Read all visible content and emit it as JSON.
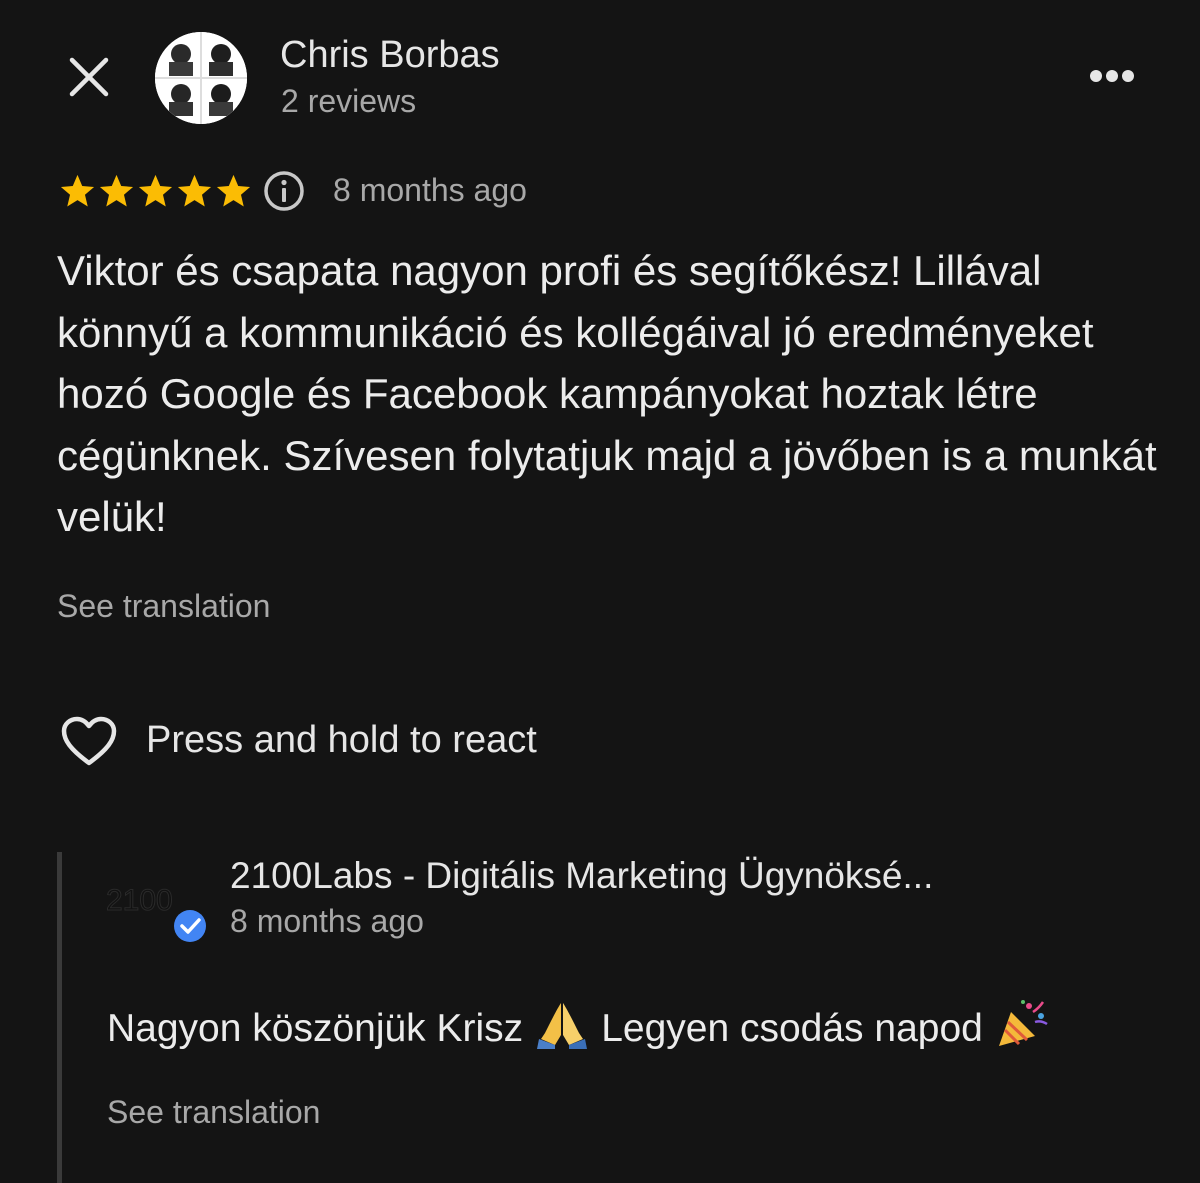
{
  "header": {
    "close_icon": "close-icon",
    "reviewer_name": "Chris Borbas",
    "review_count": "2 reviews",
    "more_icon": "more-horizontal-icon"
  },
  "review": {
    "rating": 5,
    "rating_max": 5,
    "star_color": "#fbbc04",
    "info_icon": "info-icon",
    "date": "8 months ago",
    "text": "Viktor és csapata nagyon profi és segítőkész! Lillával könnyű a kommunikáció és kollégáival jó eredményeket hozó Google és Facebook kampányokat hoztak létre cégünknek. Szívesen folytatjuk majd a jövőben is a munkát velük!",
    "see_translation": "See translation"
  },
  "react": {
    "icon": "heart-outline-icon",
    "label": "Press and hold to react"
  },
  "owner_reply": {
    "owner_name": "2100Labs - Digitális Marketing Ügynöksé...",
    "verified_icon": "verified-badge-icon",
    "verified_color": "#4285f4",
    "date": "8 months ago",
    "text_part1": "Nagyon köszönjük Krisz",
    "text_part2": "Legyen csodás napod",
    "emoji_1": "folded-hands-emoji",
    "emoji_2": "party-popper-emoji",
    "see_translation": "See translation"
  },
  "colors": {
    "background": "#141414",
    "primary_text": "#ececec",
    "secondary_text": "#a8a8a8"
  }
}
